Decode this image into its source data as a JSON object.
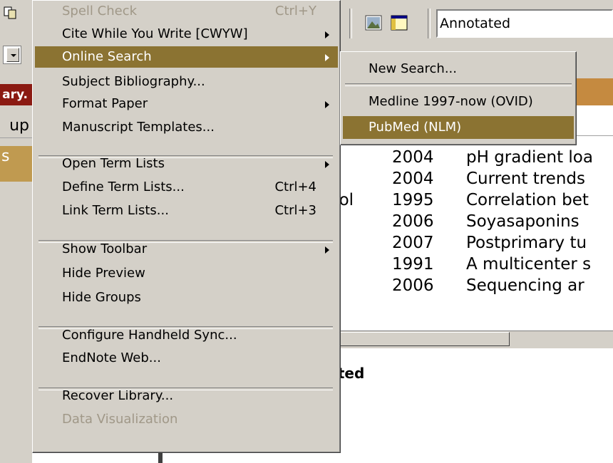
{
  "left_strip": {
    "library_text": "ary.",
    "group_text": "up",
    "s_text": "s"
  },
  "toolbar": {
    "style_select_value": "Annotated"
  },
  "references": [
    {
      "author": "",
      "year": "2004",
      "title": "pH gradient loa"
    },
    {
      "author": "",
      "year": "2004",
      "title": "Current trends"
    },
    {
      "author": "yol",
      "year": "1995",
      "title": "Correlation bet"
    },
    {
      "author": "",
      "year": "2006",
      "title": "Soyasaponins"
    },
    {
      "author": "",
      "year": "2007",
      "title": "Postprimary tu"
    },
    {
      "author": "",
      "year": "1991",
      "title": "A multicenter s"
    },
    {
      "author": "",
      "year": "2006",
      "title": "Sequencing ar"
    }
  ],
  "preview_label": "cted",
  "menu": {
    "items": [
      {
        "label": "Spell Check",
        "shortcut": "Ctrl+Y",
        "disabled": true
      },
      {
        "label": "Cite While You Write [CWYW]",
        "submenu": true
      },
      {
        "label": "Online Search",
        "submenu": true,
        "selected": true
      },
      {
        "label": "Subject Bibliography..."
      },
      {
        "label": "Format Paper",
        "submenu": true
      },
      {
        "label": "Manuscript Templates..."
      },
      {
        "label": "Open Term Lists",
        "submenu": true
      },
      {
        "label": "Define Term Lists...",
        "shortcut": "Ctrl+4"
      },
      {
        "label": "Link Term Lists...",
        "shortcut": "Ctrl+3"
      },
      {
        "label": "Show Toolbar",
        "submenu": true
      },
      {
        "label": "Hide Preview"
      },
      {
        "label": "Hide Groups"
      },
      {
        "label": "Configure Handheld Sync..."
      },
      {
        "label": "EndNote Web..."
      },
      {
        "label": "Recover Library..."
      },
      {
        "label": "Data Visualization",
        "disabled": true
      }
    ]
  },
  "submenu": {
    "items": [
      {
        "label": "New Search..."
      },
      {
        "label": "Medline 1997-now (OVID)"
      },
      {
        "label": "PubMed (NLM)",
        "selected": true
      }
    ]
  },
  "colors": {
    "menu_bg": "#d4d0c8",
    "highlight": "#8b7332",
    "disabled_text": "#a09888",
    "library_bar": "#8b1a12",
    "groups_bar": "#c09a50"
  },
  "icons": [
    "copy-icon",
    "image-icon",
    "window-icon",
    "dropdown-arrow-icon",
    "submenu-arrow-icon"
  ]
}
